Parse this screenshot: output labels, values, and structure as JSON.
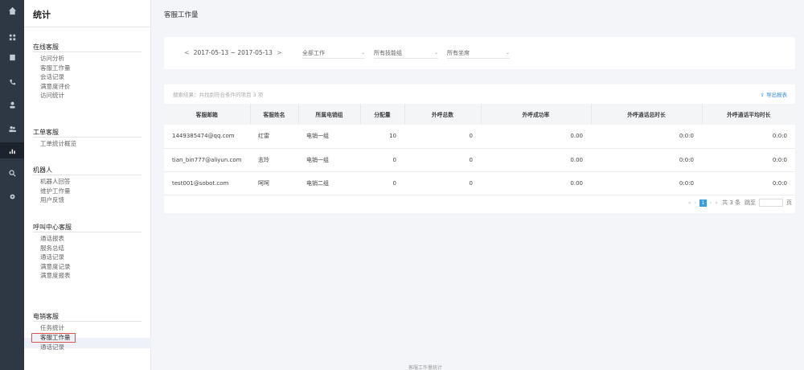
{
  "rail": {
    "icons": [
      "home-icon",
      "grid-icon",
      "book-icon",
      "phone-icon",
      "user-icon",
      "users-icon",
      "chart-icon",
      "search-icon",
      "settings-icon"
    ]
  },
  "sidebar": {
    "title": "统计",
    "groups": [
      {
        "title": "在线客服",
        "items": [
          "访问分析",
          "客服工作量",
          "会话记录",
          "满意度评价",
          "访问统计"
        ]
      },
      {
        "title": "工单客服",
        "items": [
          "工单统计概览"
        ]
      },
      {
        "title": "机器人",
        "items": [
          "机器人回答",
          "维护工作量",
          "用户反馈"
        ]
      },
      {
        "title": "呼叫中心客服",
        "items": [
          "通话报表",
          "服务总结",
          "通话记录",
          "满意度记录",
          "满意度报表"
        ]
      },
      {
        "title": "电销客服",
        "items": [
          "任务统计",
          "客服工作量",
          "通话记录"
        ]
      }
    ],
    "active_item": "客服工作量"
  },
  "main": {
    "page_title": "客服工作量",
    "filters": {
      "date_range": "2017-05-13 ~ 2017-05-13",
      "work_select": "全部工作",
      "skill_select": "所有技能组",
      "seat_select": "所有坐席"
    },
    "result_text": "搜索结果：共找到符合条件的项目 3 项",
    "export_label": "导出报表",
    "table": {
      "headers": [
        "客服邮箱",
        "客服姓名",
        "所属电销组",
        "分配量",
        "外呼总数",
        "外呼成功率",
        "外呼通话总时长",
        "外呼通话平均时长"
      ],
      "rows": [
        [
          "1449385474@qq.com",
          "红雷",
          "电销一组",
          "10",
          "0",
          "0.00",
          "0:0:0",
          "0:0:0"
        ],
        [
          "tian_bin777@aliyun.com",
          "志玲",
          "电销一组",
          "0",
          "0",
          "0.00",
          "0:0:0",
          "0:0:0"
        ],
        [
          "test001@sobot.com",
          "呵呵",
          "电销二组",
          "0",
          "0",
          "0.00",
          "0:0:0",
          "0:0:0"
        ]
      ]
    },
    "pager": {
      "current_page": "1",
      "total_label": "共 3 条",
      "jump_label": "跳至",
      "page_suffix": "页"
    }
  },
  "footer_text": "客服工作量统计"
}
